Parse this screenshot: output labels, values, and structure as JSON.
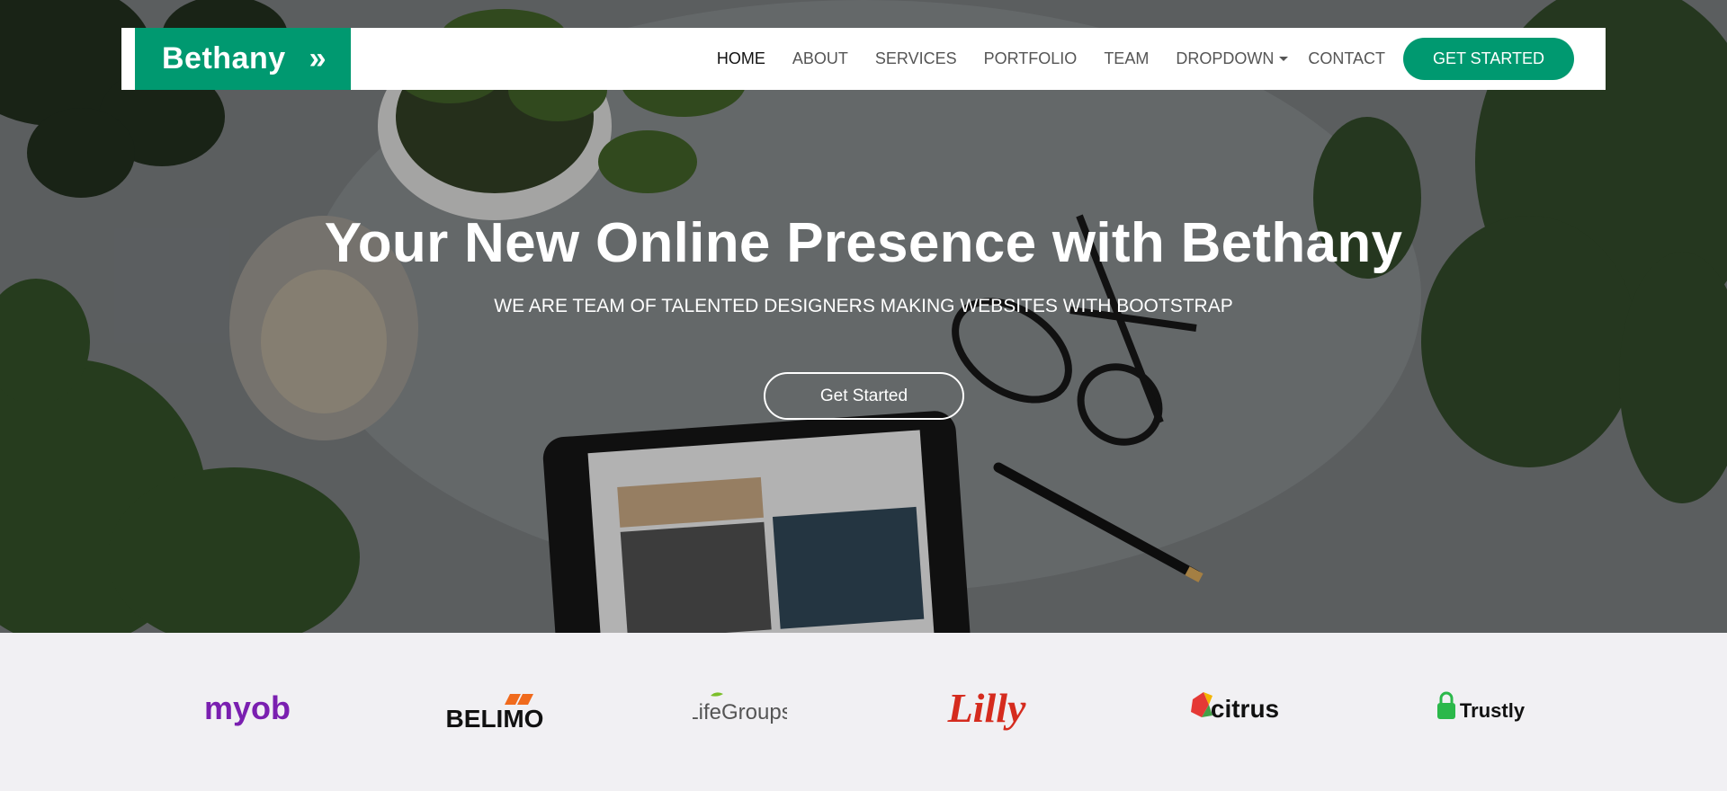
{
  "brand": {
    "name": "Bethany",
    "chevron": "»"
  },
  "nav": {
    "items": [
      {
        "label": "HOME",
        "active": true
      },
      {
        "label": "ABOUT"
      },
      {
        "label": "SERVICES"
      },
      {
        "label": "PORTFOLIO"
      },
      {
        "label": "TEAM"
      },
      {
        "label": "DROPDOWN",
        "dropdown": true
      },
      {
        "label": "CONTACT"
      }
    ],
    "cta": "GET STARTED"
  },
  "hero": {
    "title": "Your New Online Presence with Bethany",
    "subtitle": "WE ARE TEAM OF TALENTED DESIGNERS MAKING WEBSITES WITH BOOTSTRAP",
    "button": "Get Started"
  },
  "clients": [
    {
      "name": "myob",
      "color": "#7a1fb0"
    },
    {
      "name": "BELIMO",
      "color": "#111111",
      "accent": "#f06a1c"
    },
    {
      "name": "LifeGroups",
      "color": "#555555",
      "accent": "#7bbf2a"
    },
    {
      "name": "Lilly",
      "color": "#d52b1e"
    },
    {
      "name": "citrus",
      "color": "#111111",
      "accent": "#e53935"
    },
    {
      "name": "Trustly",
      "color": "#111111",
      "accent": "#2bb84a"
    }
  ],
  "colors": {
    "accent": "#009970",
    "clients_bg": "#f1f0f3"
  }
}
